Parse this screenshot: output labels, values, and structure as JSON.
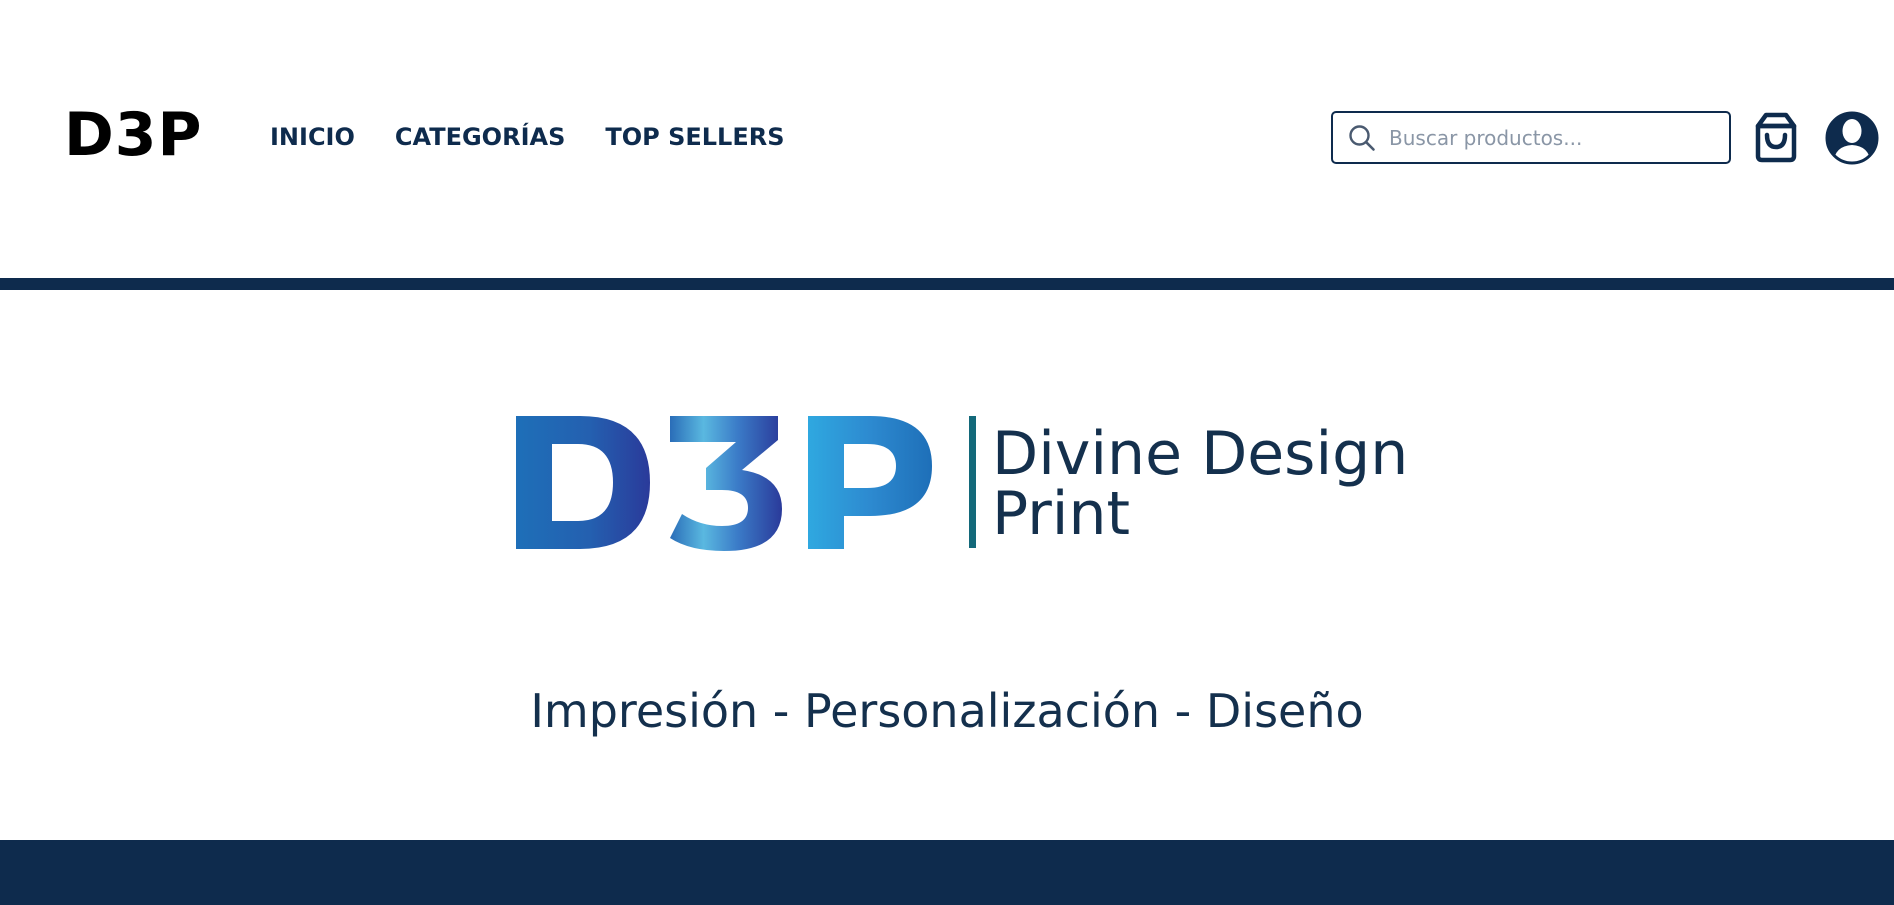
{
  "header": {
    "logo_text": "D3P",
    "nav": [
      {
        "label": "INICIO"
      },
      {
        "label": "CATEGORÍAS"
      },
      {
        "label": "TOP SELLERS"
      }
    ],
    "search": {
      "placeholder": "Buscar productos...",
      "value": ""
    },
    "icons": {
      "search": "search-icon",
      "cart": "shopping-bag-icon",
      "user": "user-avatar-icon"
    }
  },
  "hero": {
    "brand_mark": "D3P",
    "brand_name_line1": "Divine Design",
    "brand_name_line2": "Print",
    "tagline": "Impresión - Personalización - Diseño"
  },
  "colors": {
    "primary_navy": "#0e2b4d",
    "text_navy": "#14304d",
    "divider_teal": "#13697a",
    "gradient_blue_dark": "#2a3a9a",
    "gradient_blue_mid": "#1e6fb8",
    "gradient_blue_light": "#5ab8e0"
  }
}
